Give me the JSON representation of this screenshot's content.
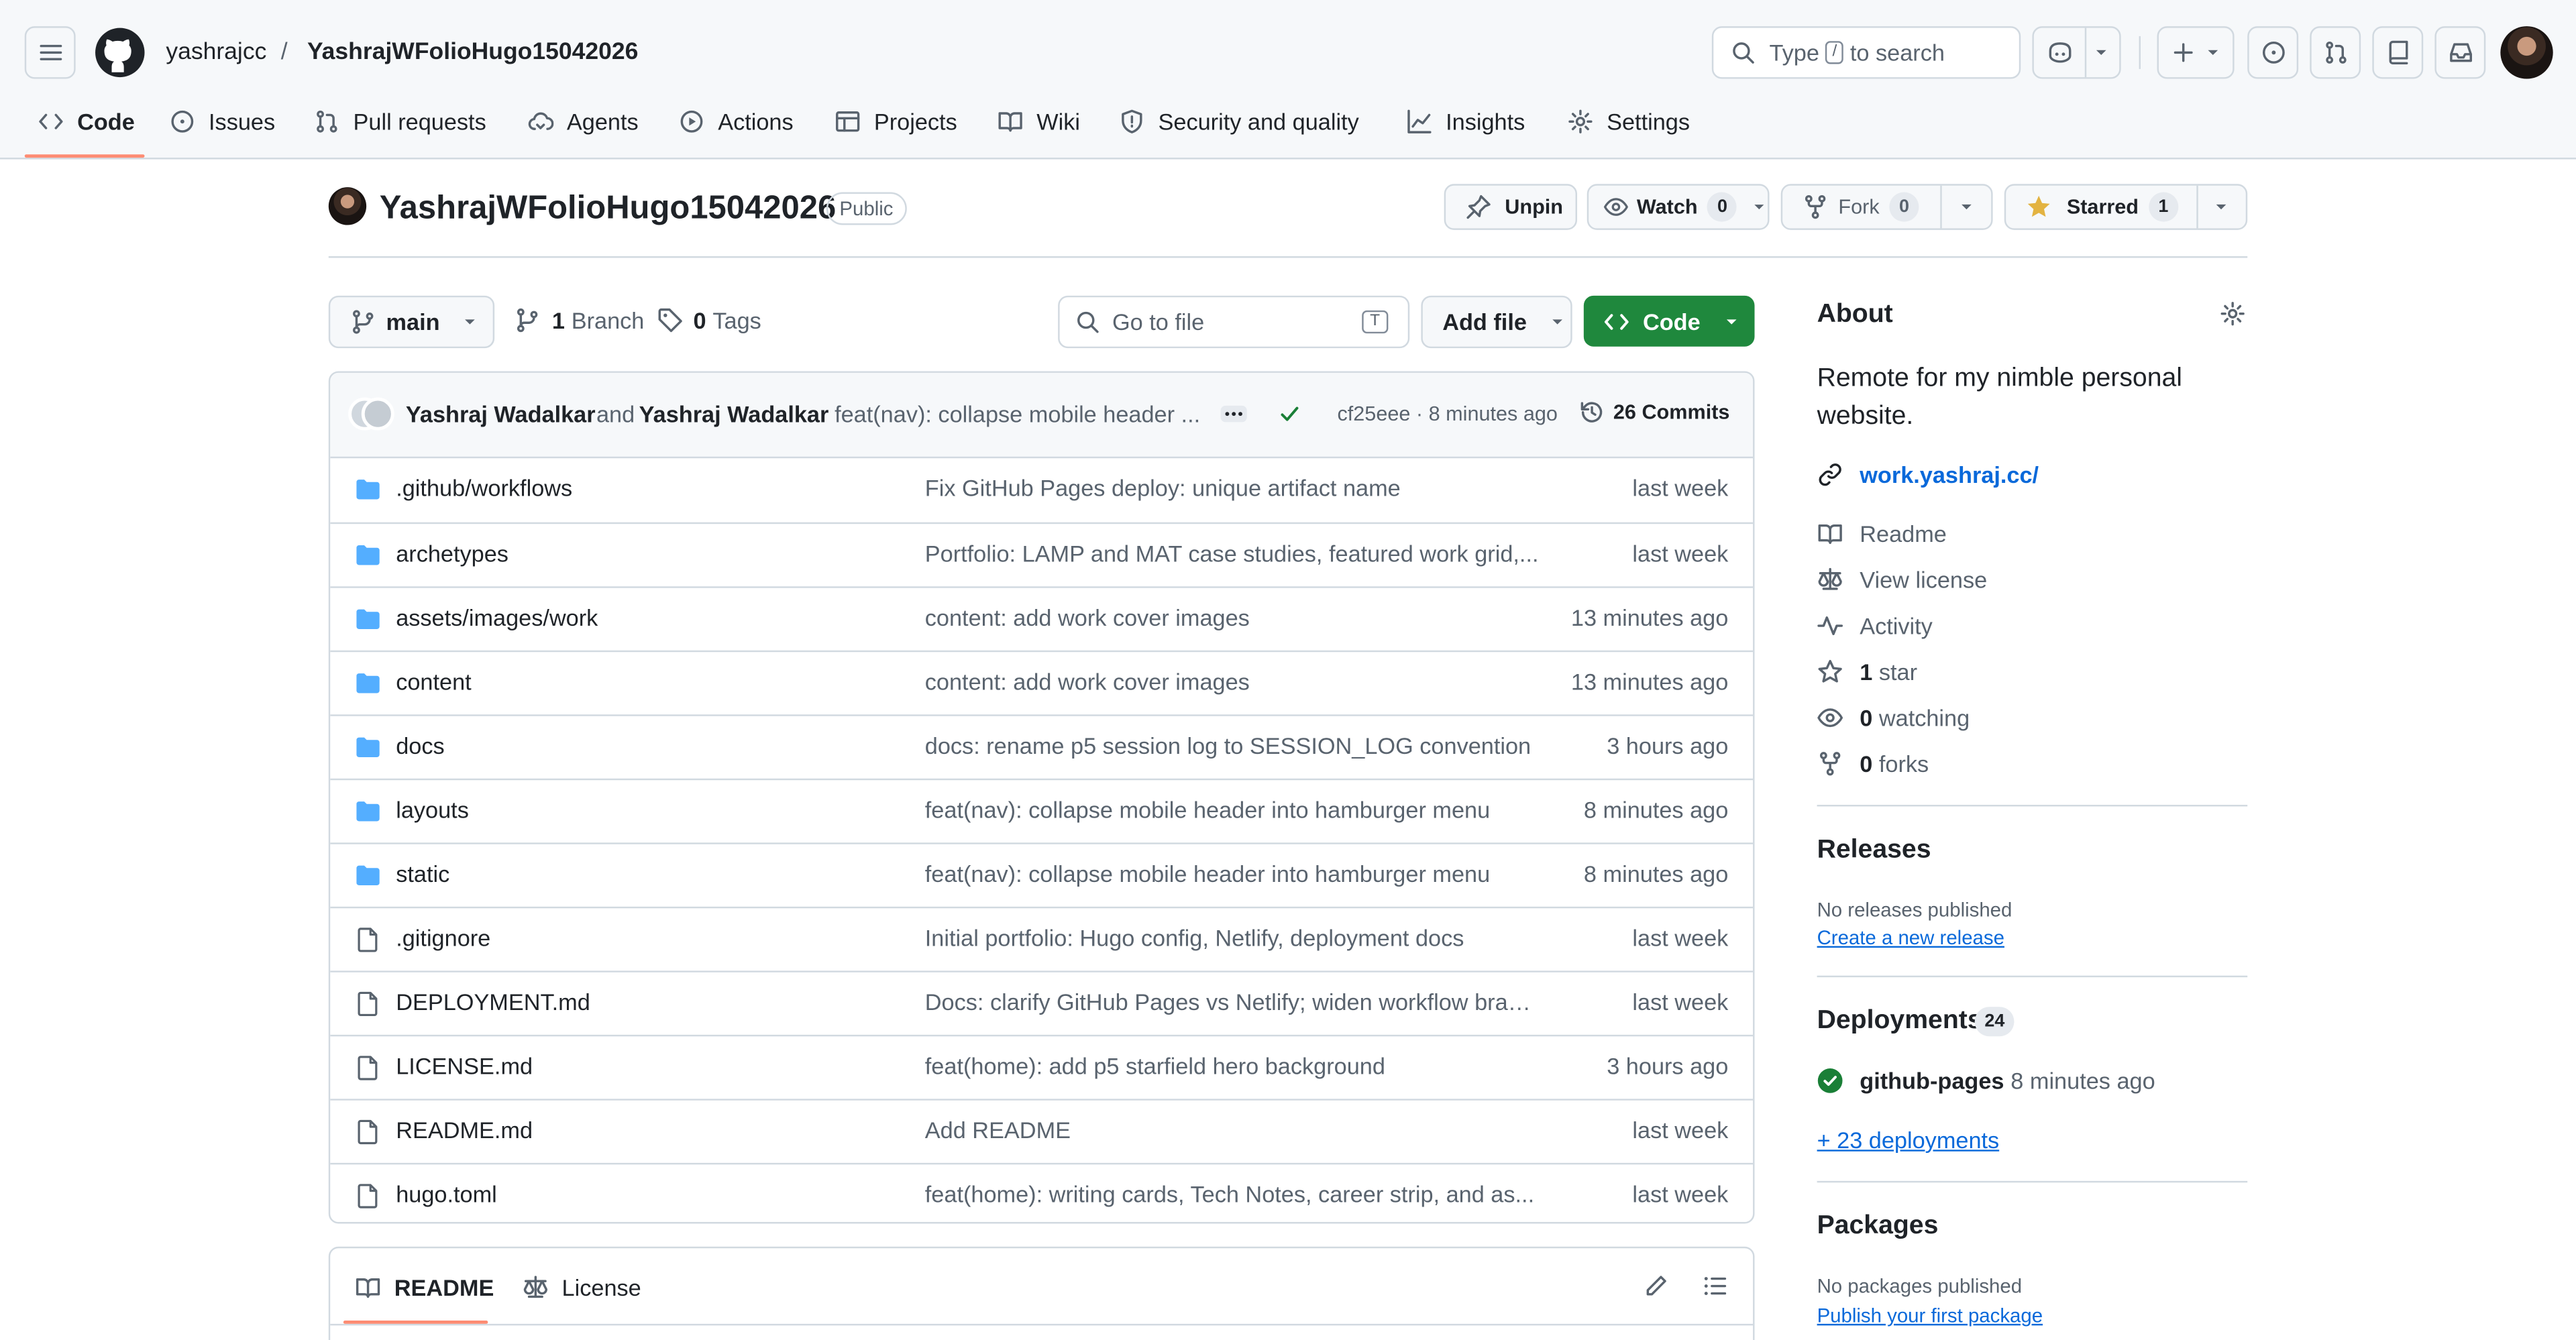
{
  "header": {
    "owner": "yashrajcc",
    "separator": "/",
    "repo": "YashrajWFolioHugo15042026",
    "search_type": "Type",
    "search_key": "/",
    "search_rest": "to search"
  },
  "nav": [
    {
      "label": "Code"
    },
    {
      "label": "Issues"
    },
    {
      "label": "Pull requests"
    },
    {
      "label": "Agents"
    },
    {
      "label": "Actions"
    },
    {
      "label": "Projects"
    },
    {
      "label": "Wiki"
    },
    {
      "label": "Security and quality"
    },
    {
      "label": "Insights"
    },
    {
      "label": "Settings"
    }
  ],
  "repo": {
    "name": "YashrajWFolioHugo15042026",
    "visibility": "Public",
    "unpin": "Unpin",
    "watch": "Watch",
    "watch_count": "0",
    "fork": "Fork",
    "fork_count": "0",
    "starred": "Starred",
    "star_count": "1"
  },
  "toolbar": {
    "branch": "main",
    "branch_count": "1",
    "branch_label": "Branch",
    "tag_count": "0",
    "tag_label": "Tags",
    "goto_placeholder": "Go to file",
    "goto_key": "T",
    "add_file": "Add file",
    "code": "Code"
  },
  "commit": {
    "author1": "Yashraj Wadalkar",
    "and": "and",
    "author2": "Yashraj Wadalkar",
    "message": "feat(nav): collapse mobile header ...",
    "hash_time": "cf25eee · 8 minutes ago",
    "commits": "26 Commits"
  },
  "files": [
    {
      "type": "dir",
      "name": ".github/workflows",
      "message": "Fix GitHub Pages deploy: unique artifact name",
      "date": "last week"
    },
    {
      "type": "dir",
      "name": "archetypes",
      "message": "Portfolio: LAMP and MAT case studies, featured work grid,...",
      "date": "last week"
    },
    {
      "type": "dir",
      "name": "assets/images/work",
      "message": "content: add work cover images",
      "date": "13 minutes ago"
    },
    {
      "type": "dir",
      "name": "content",
      "message": "content: add work cover images",
      "date": "13 minutes ago"
    },
    {
      "type": "dir",
      "name": "docs",
      "message": "docs: rename p5 session log to SESSION_LOG convention",
      "date": "3 hours ago"
    },
    {
      "type": "dir",
      "name": "layouts",
      "message": "feat(nav): collapse mobile header into hamburger menu",
      "date": "8 minutes ago"
    },
    {
      "type": "dir",
      "name": "static",
      "message": "feat(nav): collapse mobile header into hamburger menu",
      "date": "8 minutes ago"
    },
    {
      "type": "file",
      "name": ".gitignore",
      "message": "Initial portfolio: Hugo config, Netlify, deployment docs",
      "date": "last week"
    },
    {
      "type": "file",
      "name": "DEPLOYMENT.md",
      "message": "Docs: clarify GitHub Pages vs Netlify; widen workflow bran...",
      "date": "last week"
    },
    {
      "type": "file",
      "name": "LICENSE.md",
      "message": "feat(home): add p5 starfield hero background",
      "date": "3 hours ago"
    },
    {
      "type": "file",
      "name": "README.md",
      "message": "Add README",
      "date": "last week"
    },
    {
      "type": "file",
      "name": "hugo.toml",
      "message": "feat(home): writing cards, Tech Notes, career strip, and as...",
      "date": "last week"
    }
  ],
  "readme_tabs": {
    "readme": "README",
    "license": "License"
  },
  "about": {
    "title": "About",
    "description": "Remote for my nimble personal website.",
    "website": "work.yashraj.cc/",
    "readme": "Readme",
    "license": "View license",
    "activity": "Activity",
    "stars_n": "1",
    "stars": "star",
    "watching_n": "0",
    "watching": "watching",
    "forks_n": "0",
    "forks": "forks"
  },
  "releases": {
    "title": "Releases",
    "none": "No releases published",
    "create": "Create a new release"
  },
  "deployments": {
    "title": "Deployments",
    "count": "24",
    "env": "github-pages",
    "time": "8 minutes ago",
    "more": "+ 23 deployments"
  },
  "packages": {
    "title": "Packages",
    "none": "No packages published",
    "publish": "Publish your first package"
  }
}
